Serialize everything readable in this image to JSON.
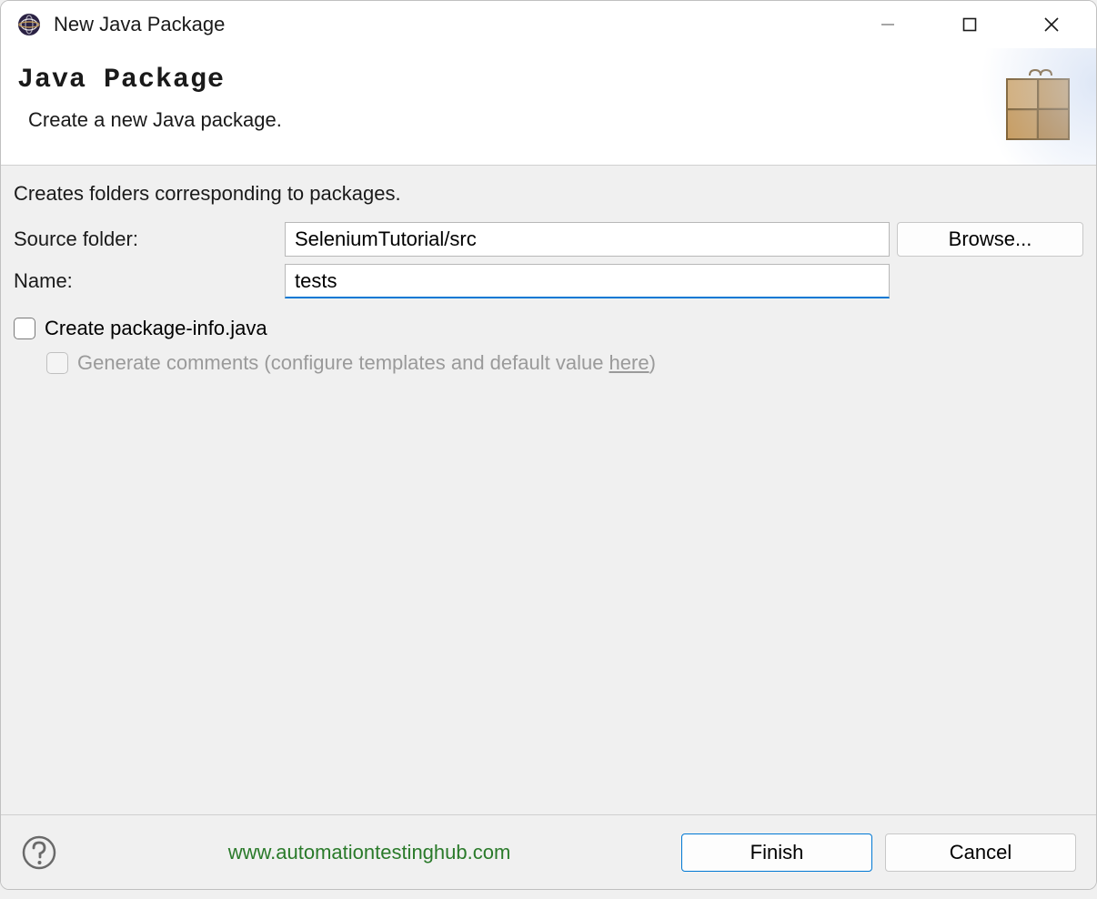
{
  "window": {
    "title": "New Java Package"
  },
  "header": {
    "title": "Java Package",
    "subtitle": "Create a new Java package."
  },
  "body": {
    "description": "Creates folders corresponding to packages.",
    "source_folder_label": "Source folder:",
    "source_folder_value": "SeleniumTutorial/src",
    "browse_label": "Browse...",
    "name_label": "Name:",
    "name_value": "tests",
    "checkbox_package_info": "Create package-info.java",
    "checkbox_generate_pre": "Generate comments (configure templates and default value ",
    "checkbox_generate_link": "here",
    "checkbox_generate_post": ")"
  },
  "footer": {
    "watermark": "www.automationtestinghub.com",
    "finish_label": "Finish",
    "cancel_label": "Cancel"
  }
}
